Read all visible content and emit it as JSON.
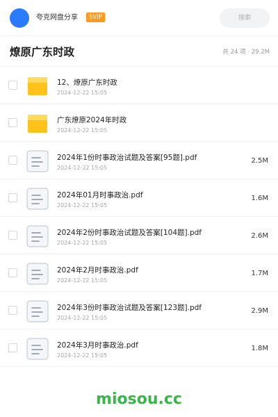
{
  "header": {
    "username": "夸克网盘分享",
    "badge": "SVIP",
    "search_placeholder": "搜索"
  },
  "folder": {
    "title": "燎原广东时政",
    "summary": "共 24 项 · 29.2M"
  },
  "files": [
    {
      "name": "12、燎原广东时政",
      "date": "2024-12-22 15:05",
      "size": "",
      "type": "folder"
    },
    {
      "name": "广东燎原2024年时政",
      "date": "2024-12-22 15:05",
      "size": "",
      "type": "folder"
    },
    {
      "name": "2024年1份时事政治试题及答案[95题].pdf",
      "date": "2024-12-22 15:05",
      "size": "2.5M",
      "type": "doc"
    },
    {
      "name": "2024年01月时事政治.pdf",
      "date": "2024-12-22 15:05",
      "size": "1.6M",
      "type": "doc"
    },
    {
      "name": "2024年2份时事政治试题及答案[104题].pdf",
      "date": "2024-12-22 15:05",
      "size": "2.6M",
      "type": "doc"
    },
    {
      "name": "2024年2月时事政治.pdf",
      "date": "2024-12-22 15:05",
      "size": "1.7M",
      "type": "doc"
    },
    {
      "name": "2024年3份时事政治试题及答案[123题].pdf",
      "date": "2024-12-22 15:05",
      "size": "2.9M",
      "type": "doc"
    },
    {
      "name": "2024年3月时事政治.pdf",
      "date": "2024-12-22 15:05",
      "size": "1.8M",
      "type": "doc"
    }
  ],
  "footer": {
    "brand": "miosou.cc"
  },
  "colors": {
    "avatar": "#2b7bff",
    "badge": "#ff9a1f",
    "folder": "#ffc21a",
    "brand": "#3ab54a"
  }
}
